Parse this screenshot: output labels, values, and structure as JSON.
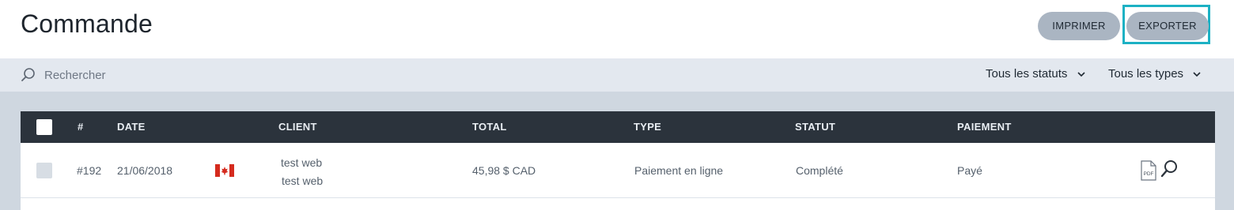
{
  "header": {
    "title": "Commande",
    "print_label": "IMPRIMER",
    "export_label": "EXPORTER"
  },
  "search": {
    "placeholder": "Rechercher",
    "value": ""
  },
  "filters": {
    "status_label": "Tous les statuts",
    "type_label": "Tous les types"
  },
  "table": {
    "columns": {
      "number": "#",
      "date": "DATE",
      "client": "CLIENT",
      "total": "TOTAL",
      "type": "TYPE",
      "status": "STATUT",
      "payment": "PAIEMENT"
    },
    "rows": [
      {
        "number": "#192",
        "date": "21/06/2018",
        "flag": "canada-flag-icon",
        "client_line1": "test web",
        "client_line2": "test web",
        "total": "45,98 $ CAD",
        "type": "Paiement en ligne",
        "status": "Complété",
        "payment": "Payé",
        "pdf_icon_text": "PDF"
      }
    ]
  },
  "icons": {
    "search": "search-icon",
    "chevron": "chevron-down-icon",
    "pdf": "pdf-icon",
    "view": "magnifier-icon"
  },
  "colors": {
    "button_bg": "#aab5c2",
    "focus_ring": "#1cb1c4",
    "table_header_bg": "#2b333c",
    "search_bar_bg": "#e3e8ef",
    "content_bg": "#cfd7e0",
    "flag_red": "#d52b1e"
  }
}
